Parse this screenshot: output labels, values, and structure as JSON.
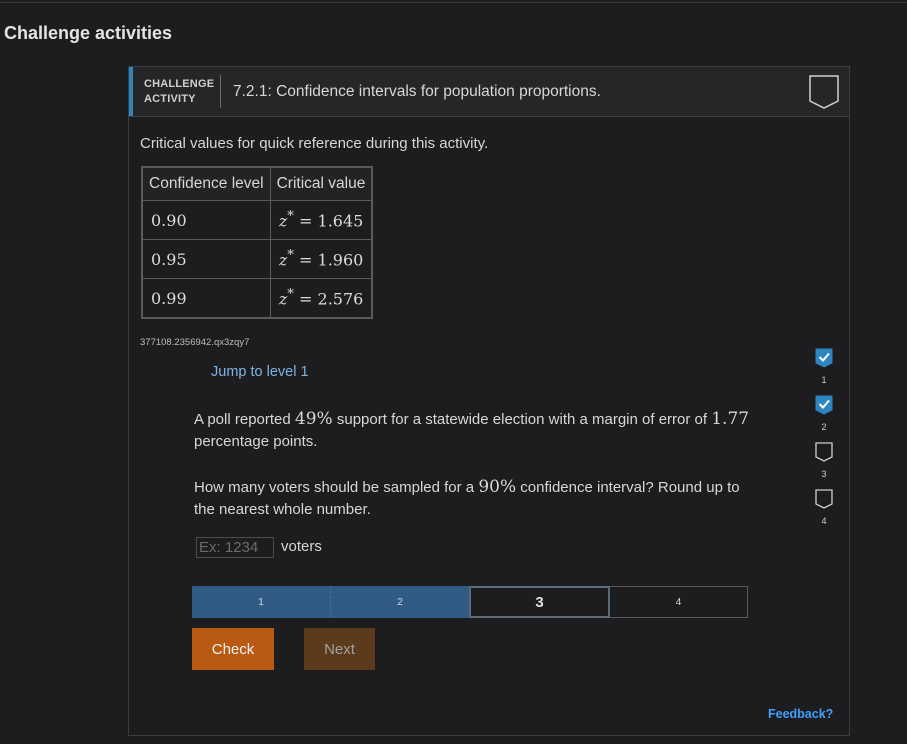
{
  "page": {
    "section_title": "Challenge activities"
  },
  "activity": {
    "label_line1": "CHALLENGE",
    "label_line2": "ACTIVITY",
    "title": "7.2.1: Confidence intervals for population proportions.",
    "reference_text": "Critical values for quick reference during this activity.",
    "table": {
      "headers": [
        "Confidence level",
        "Critical value"
      ],
      "rows": [
        {
          "level": "0.90",
          "zvar": "z",
          "zstar": "*",
          "eq": " = ",
          "value": "1.645"
        },
        {
          "level": "0.95",
          "zvar": "z",
          "zstar": "*",
          "eq": " = ",
          "value": "1.960"
        },
        {
          "level": "0.99",
          "zvar": "z",
          "zstar": "*",
          "eq": " = ",
          "value": "2.576"
        }
      ]
    },
    "content_id": "377108.2356942.qx3zqy7",
    "jump_link": "Jump to level 1",
    "question": {
      "p1_a": "A poll reported ",
      "p1_math1": "49%",
      "p1_b": " support for a statewide election with a margin of error of ",
      "p1_math2": "1.77",
      "p1_c": " percentage points.",
      "p2_a": "How many voters should be sampled for a ",
      "p2_math": "90%",
      "p2_b": " confidence interval? Round up to the nearest whole number."
    },
    "answer": {
      "value": "",
      "placeholder": "Ex: 1234",
      "unit": "voters"
    },
    "progress": {
      "segments": [
        "1",
        "2",
        "3",
        "4"
      ],
      "completed": 2,
      "current": 3
    },
    "buttons": {
      "check": "Check",
      "next": "Next"
    },
    "levels": [
      {
        "num": "1",
        "status": "complete"
      },
      {
        "num": "2",
        "status": "complete"
      },
      {
        "num": "3",
        "status": "incomplete"
      },
      {
        "num": "4",
        "status": "incomplete"
      }
    ],
    "feedback": "Feedback?"
  },
  "colors": {
    "background": "#1d1d1f",
    "accent_blue": "#2e86c1",
    "progress_done": "#2f5b85",
    "check_button": "#b85a12",
    "next_button": "#5c3a1c",
    "link": "#7db4e6",
    "feedback_link": "#3ea0ff"
  },
  "icons": {
    "level_complete": "checked-checkbox-icon",
    "level_incomplete": "empty-checkbox-icon",
    "header_badge": "completion-badge-icon"
  }
}
